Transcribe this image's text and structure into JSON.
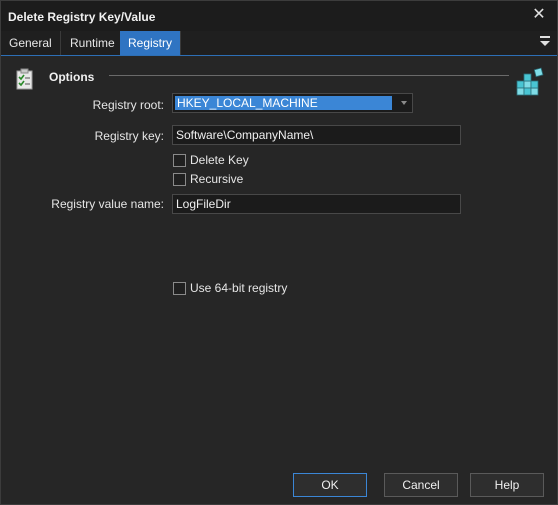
{
  "window": {
    "title": "Delete Registry Key/Value"
  },
  "tabs": [
    {
      "label": "General",
      "active": false
    },
    {
      "label": "Runtime",
      "active": false
    },
    {
      "label": "Registry",
      "active": true
    }
  ],
  "section": {
    "label": "Options",
    "icon": "checklist-icon",
    "badge_icon": "registry-icon"
  },
  "fields": {
    "registry_root": {
      "label": "Registry root:",
      "value": "HKEY_LOCAL_MACHINE"
    },
    "registry_key": {
      "label": "Registry key:",
      "value": "Software\\CompanyName\\"
    },
    "registry_value_name": {
      "label": "Registry value name:",
      "value": "LogFileDir"
    }
  },
  "checkboxes": {
    "delete_key": {
      "label": "Delete Key",
      "checked": false
    },
    "recursive": {
      "label": "Recursive",
      "checked": false
    },
    "use_64bit": {
      "label": "Use 64-bit registry",
      "checked": false
    }
  },
  "buttons": {
    "ok": "OK",
    "cancel": "Cancel",
    "help": "Help"
  },
  "colors": {
    "accent": "#2f74c2",
    "selection": "#3b86d6",
    "background": "#262626"
  }
}
